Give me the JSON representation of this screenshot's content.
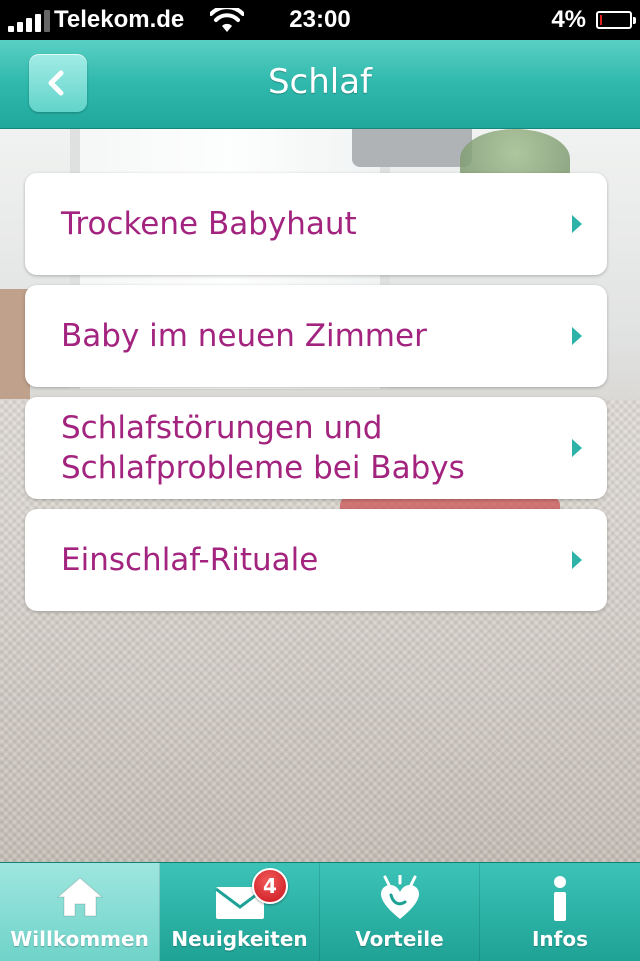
{
  "status_bar": {
    "carrier": "Telekom.de",
    "time": "23:00",
    "battery_percent": "4%",
    "battery_level": 0.04,
    "signal_bars": 4
  },
  "nav": {
    "title": "Schlaf",
    "back_icon": "chevron-left-icon"
  },
  "list": {
    "items": [
      {
        "label": "Trockene Babyhaut"
      },
      {
        "label": "Baby im neuen Zimmer"
      },
      {
        "label": "Schlafstörungen und\nSchlafprobleme bei Babys"
      },
      {
        "label": "Einschlaf-Rituale"
      }
    ]
  },
  "tabs": [
    {
      "label": "Willkommen",
      "icon": "home-icon",
      "active": true
    },
    {
      "label": "Neuigkeiten",
      "icon": "mail-icon",
      "badge": "4"
    },
    {
      "label": "Vorteile",
      "icon": "heart-icon"
    },
    {
      "label": "Infos",
      "icon": "info-icon"
    }
  ],
  "colors": {
    "accent": "#2fb8ac",
    "item_text": "#a3247f",
    "badge": "#d4161e"
  }
}
